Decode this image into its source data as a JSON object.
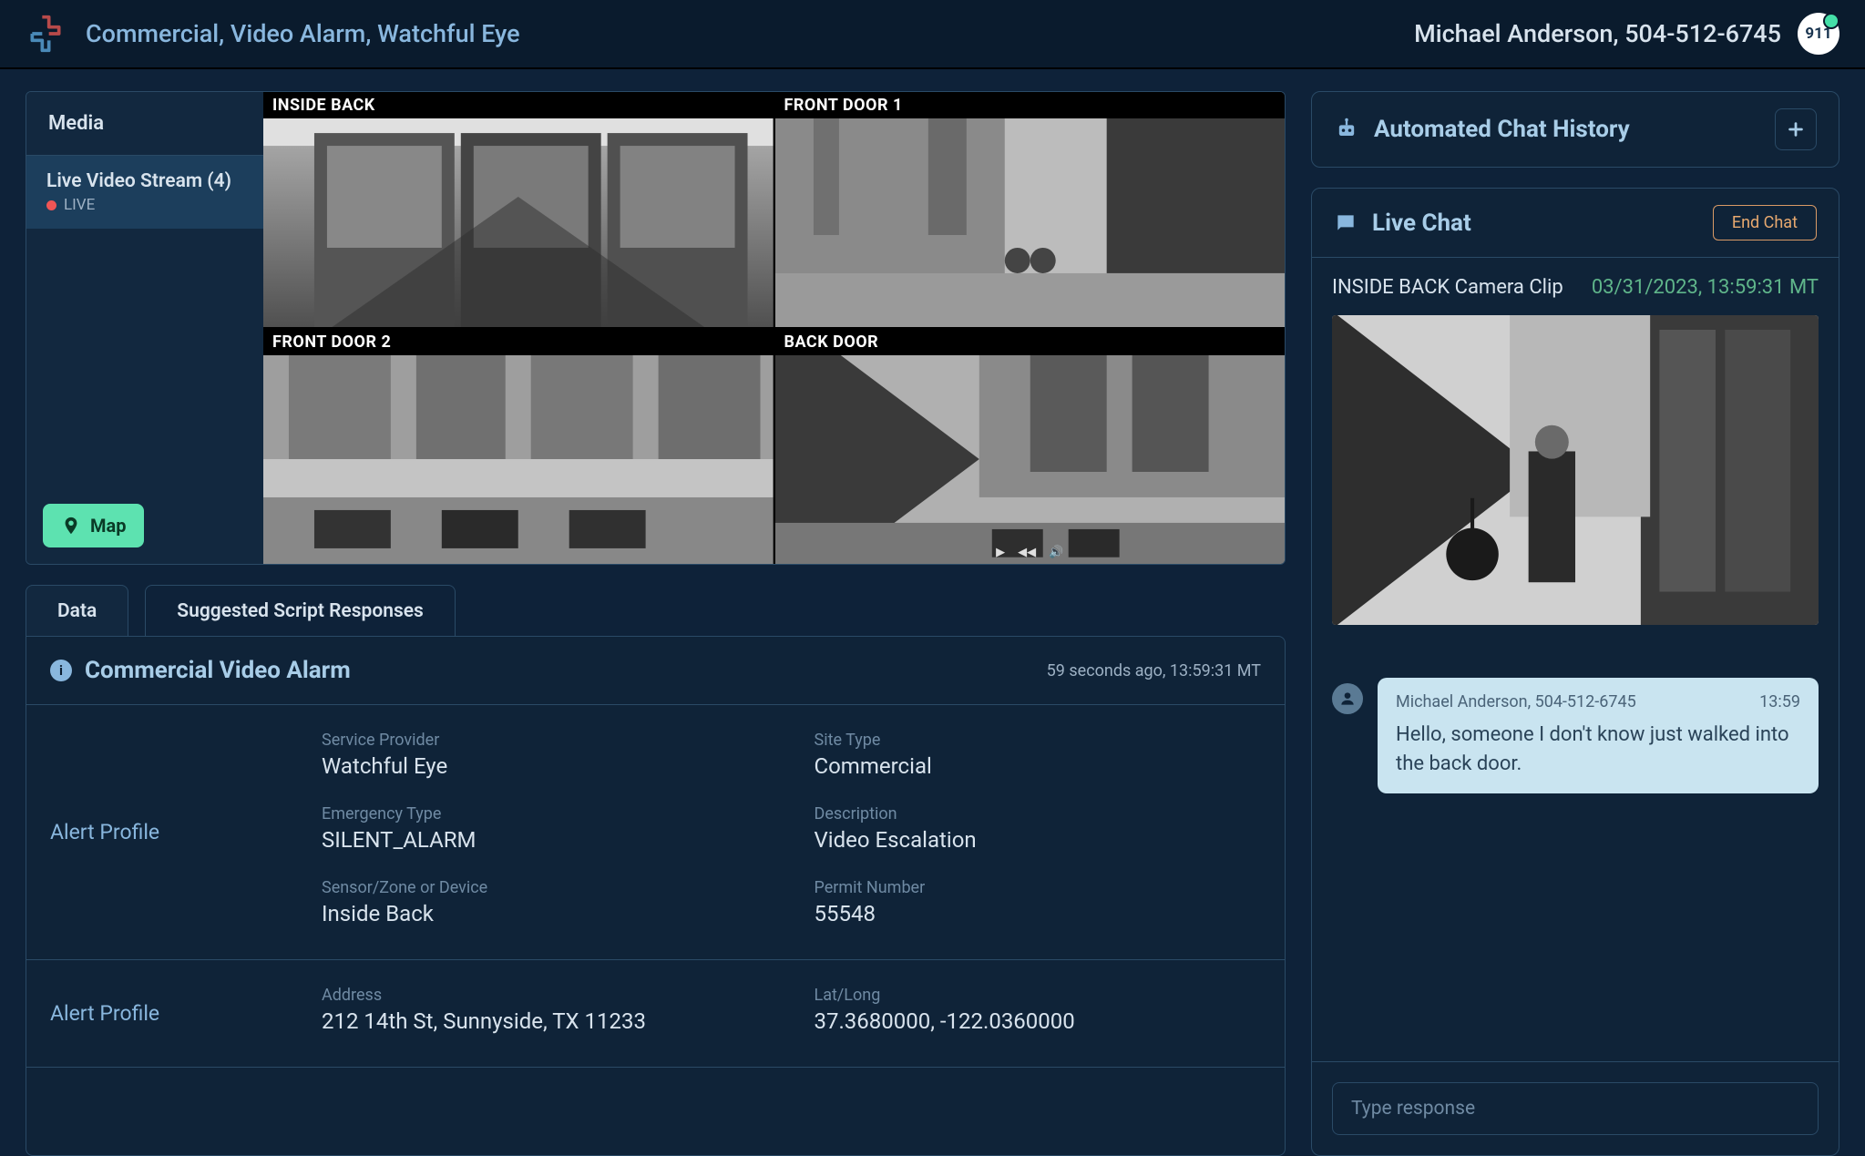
{
  "header": {
    "breadcrumb": "Commercial, Video Alarm, Watchful Eye",
    "caller": "Michael Anderson, 504-512-6745",
    "badge": "911"
  },
  "media": {
    "sidebar_title": "Media",
    "stream_title": "Live Video Stream (4)",
    "live_label": "LIVE",
    "map_label": "Map",
    "feeds": [
      {
        "label": "INSIDE BACK"
      },
      {
        "label": "FRONT DOOR 1"
      },
      {
        "label": "FRONT DOOR 2"
      },
      {
        "label": "BACK DOOR"
      }
    ]
  },
  "tabs": {
    "data": "Data",
    "scripts": "Suggested Script Responses"
  },
  "data_card": {
    "title": "Commercial Video Alarm",
    "timestamp": "59 seconds ago, 13:59:31 MT",
    "sections": [
      {
        "label": "Alert Profile",
        "fields": [
          {
            "label": "Service Provider",
            "value": "Watchful Eye"
          },
          {
            "label": "Site Type",
            "value": "Commercial"
          },
          {
            "label": "Emergency Type",
            "value": "SILENT_ALARM"
          },
          {
            "label": "Description",
            "value": "Video Escalation"
          },
          {
            "label": "Sensor/Zone or Device",
            "value": "Inside Back"
          },
          {
            "label": "Permit Number",
            "value": "55548"
          }
        ]
      },
      {
        "label": "Alert Profile",
        "fields": [
          {
            "label": "Address",
            "value": "212 14th St, Sunnyside, TX 11233"
          },
          {
            "label": "Lat/Long",
            "value": "37.3680000, -122.0360000"
          }
        ]
      }
    ]
  },
  "automated_chat": {
    "title": "Automated Chat History"
  },
  "live_chat": {
    "title": "Live Chat",
    "end_label": "End Chat",
    "clip_label": "INSIDE BACK Camera Clip",
    "clip_time": "03/31/2023, 13:59:31 MT",
    "message": {
      "from": "Michael Anderson, 504-512-6745",
      "time": "13:59",
      "text": "Hello, someone I don't know just walked into the back door."
    },
    "input_placeholder": "Type response"
  }
}
